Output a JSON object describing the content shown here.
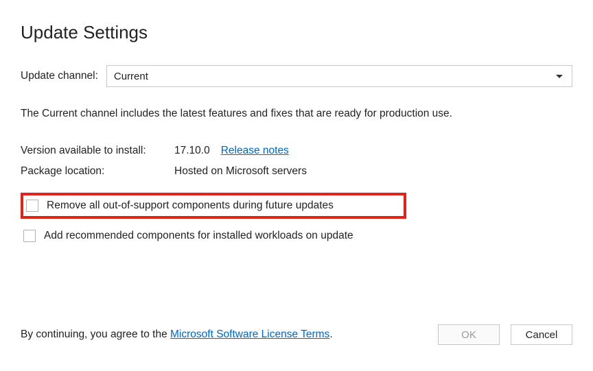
{
  "title": "Update Settings",
  "channel": {
    "label": "Update channel:",
    "selected": "Current"
  },
  "description": "The Current channel includes the latest features and fixes that are ready for production use.",
  "version": {
    "label": "Version available to install:",
    "value": "17.10.0",
    "release_notes": "Release notes"
  },
  "package": {
    "label": "Package location:",
    "value": "Hosted on Microsoft servers"
  },
  "checkboxes": {
    "remove": "Remove all out-of-support components during future updates",
    "add": "Add recommended components for installed workloads on update"
  },
  "consent": {
    "prefix": "By continuing, you agree to the ",
    "link": "Microsoft Software License Terms",
    "suffix": "."
  },
  "buttons": {
    "ok": "OK",
    "cancel": "Cancel"
  }
}
